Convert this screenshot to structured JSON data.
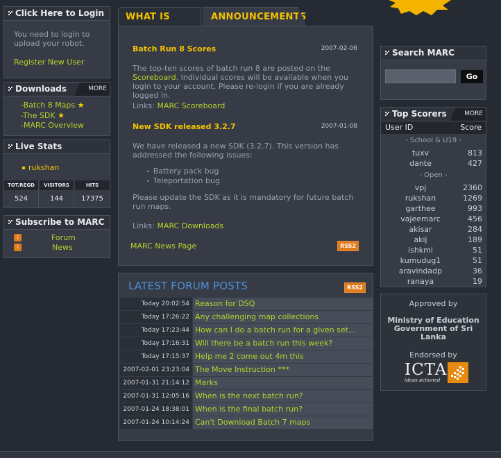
{
  "login": {
    "title": "Click Here to Login",
    "message": "You need to login to upload your robot.",
    "register_link": "Register New User"
  },
  "downloads": {
    "title": "Downloads",
    "more": "MORE",
    "items": [
      {
        "label": "-Batch 8 Maps",
        "star": true
      },
      {
        "label": "-The SDK",
        "star": true
      },
      {
        "label": "-MARC Overview",
        "star": false
      }
    ]
  },
  "live_stats": {
    "title": "Live Stats",
    "online_user": "rukshan",
    "headers": [
      "TOT.REGD",
      "VISITORS",
      "HITS"
    ],
    "values": [
      "524",
      "144",
      "17375"
    ]
  },
  "subscribe": {
    "title": "Subscribe to MARC",
    "items": [
      "Forum",
      "News"
    ]
  },
  "tabs": {
    "what_is": "WHAT IS MARC?",
    "announcements": "ANNOUNCEMENTS"
  },
  "announcements": [
    {
      "title": "Batch Run 8 Scores",
      "date": "2007-02-06",
      "body_before": "The top-ten scores of batch run 8 are posted on the ",
      "body_link": "Scoreboard",
      "body_after": ". Individual scores will be available when you login to your account. Please re-login if you are already logged in.",
      "links_label": "Links:",
      "link": "MARC Scoreboard"
    },
    {
      "title": "New SDK released 3.2.7",
      "date": "2007-01-08",
      "body": "We have released a new SDK (3.2.7). This version has addressed the following issues:",
      "bullets": [
        "Battery pack bug",
        "Teleportation bug"
      ],
      "body2": "Please update the SDK as it is mandatory for future batch run maps.",
      "links_label": "Links:",
      "link": "MARC Downloads"
    }
  ],
  "news_page_link": "MARC News Page",
  "rss_label": "RSS2",
  "forum": {
    "title": "LATEST FORUM POSTS",
    "rss": "RSS2",
    "posts": [
      {
        "time": "Today 20:02:54",
        "title": "Reason for DSQ"
      },
      {
        "time": "Today 17:26:22",
        "title": "Any challenging map collections"
      },
      {
        "time": "Today 17:23:44",
        "title": "How can I do a batch run for a given set..."
      },
      {
        "time": "Today 17:16:31",
        "title": "Will there be a batch run this week?"
      },
      {
        "time": "Today 17:15:37",
        "title": "Help me 2 come out 4m this"
      },
      {
        "time": "2007-02-01 23:23:04",
        "title": "The Move Instruction ***"
      },
      {
        "time": "2007-01-31 21:14:12",
        "title": "Marks"
      },
      {
        "time": "2007-01-31 12:05:16",
        "title": "When is the next batch run?"
      },
      {
        "time": "2007-01-24 18:38:01",
        "title": "When is the final batch run?"
      },
      {
        "time": "2007-01-24 10:14:24",
        "title": "Can't Download Batch 7 maps"
      }
    ]
  },
  "search": {
    "title": "Search MARC",
    "button": "Go",
    "value": ""
  },
  "top_scorers": {
    "title": "Top Scorers",
    "more": "MORE",
    "col_user": "User ID",
    "col_score": "Score",
    "group1": "- School & U19 -",
    "school": [
      {
        "name": "tuxv",
        "score": "813"
      },
      {
        "name": "dante",
        "score": "427"
      }
    ],
    "group2": "- Open -",
    "open": [
      {
        "name": "vpj",
        "score": "2360"
      },
      {
        "name": "rukshan",
        "score": "1269"
      },
      {
        "name": "garthee",
        "score": "993"
      },
      {
        "name": "vajeemarc",
        "score": "456"
      },
      {
        "name": "akisar",
        "score": "284"
      },
      {
        "name": "akij",
        "score": "189"
      },
      {
        "name": "ishkmi",
        "score": "51"
      },
      {
        "name": "kumudug1",
        "score": "51"
      },
      {
        "name": "aravindadp",
        "score": "36"
      },
      {
        "name": "ranaya",
        "score": "19"
      }
    ]
  },
  "sponsors": {
    "approved_by": "Approved by",
    "ministry_line1": "Ministry of Education",
    "ministry_line2": "Government of Sri Lanka",
    "endorsed_by": "Endorsed by",
    "icta_logo": "ICTA",
    "icta_tagline": "ideas actioned"
  },
  "colors": {
    "background": "#262a32",
    "panel": "#363b46",
    "link_green": "#b8d22c",
    "heading_yellow": "#f5c400",
    "rss_orange": "#e07a1a"
  }
}
